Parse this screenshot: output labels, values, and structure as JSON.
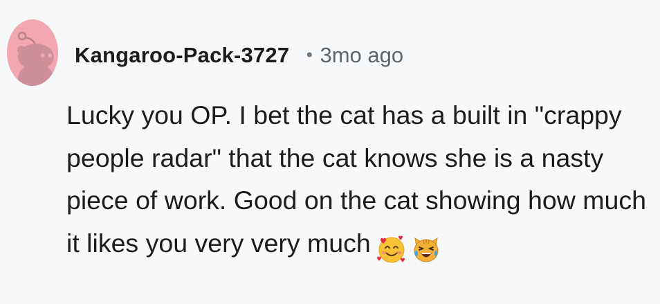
{
  "comment": {
    "author": "Kangaroo-Pack-3727",
    "separator": "•",
    "time": "3mo ago",
    "body": "Lucky you OP. I bet the cat has a built in \"crappy people radar\" that the cat knows she is a nasty piece of work. Good on the cat showing how much it likes you very very much",
    "emojis": [
      "smiling-face-with-hearts-emoji",
      "cat-face-with-tears-of-joy-emoji"
    ],
    "avatar_icon": "reddit-snoo-avatar-icon",
    "colors": {
      "avatar_bg": "#f2a7b3",
      "background": "#f7f8fa",
      "text": "#1c1c1c",
      "meta": "#5f6468"
    }
  }
}
